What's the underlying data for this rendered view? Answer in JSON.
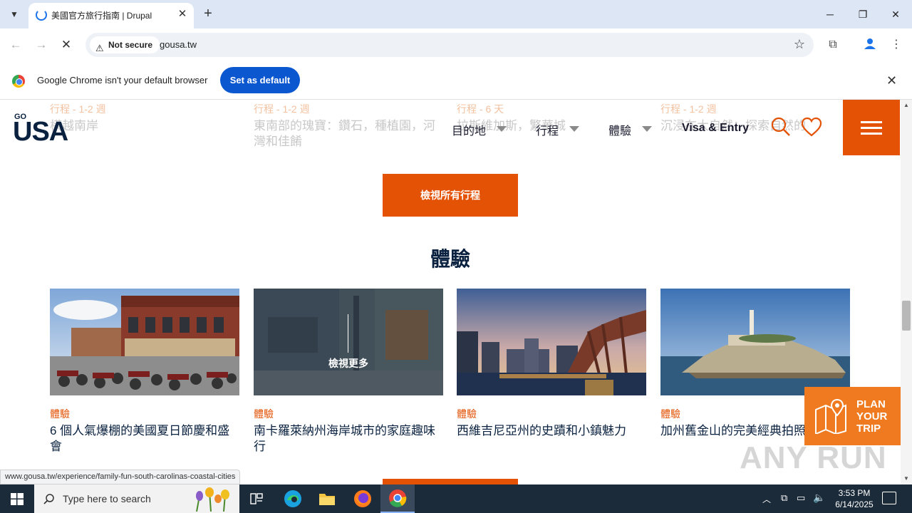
{
  "browser": {
    "tab_title": "美國官方旅行指南 | Drupal",
    "security_label": "Not secure",
    "url": "gousa.tw",
    "infobar_message": "Google Chrome isn't your default browser",
    "set_default_label": "Set as default",
    "status_url": "www.gousa.tw/experience/family-fun-south-carolinas-coastal-cities"
  },
  "faded_trips": [
    {
      "meta": "行程 - 1-2 週",
      "title": "橫越南岸"
    },
    {
      "meta": "行程 - 1-2 週",
      "title": "東南部的瑰寶：鑽石，種植園，河灣和佳餚"
    },
    {
      "meta": "行程 - 6 天",
      "title": "拉斯維加斯，繁華城"
    },
    {
      "meta": "行程 - 1-2 週",
      "title": "沉浸在大自然：探索自然的"
    }
  ],
  "header": {
    "logo_go": "GO",
    "logo_usa": "USA",
    "nav_destinations": "目的地",
    "nav_trips": "行程",
    "nav_experiences": "體驗",
    "nav_visa": "Visa & Entry"
  },
  "main": {
    "view_all_trips": "檢視所有行程",
    "section_title": "體驗",
    "view_more": "檢視更多",
    "cards": [
      {
        "tag": "體驗",
        "title": "6 個人氣爆棚的美國夏日節慶和盛會"
      },
      {
        "tag": "體驗",
        "title": "南卡羅萊納州海岸城市的家庭趣味行"
      },
      {
        "tag": "體驗",
        "title": "西維吉尼亞州的史蹟和小鎮魅力"
      },
      {
        "tag": "體驗",
        "title": "加州舊金山的完美經典拍照"
      }
    ]
  },
  "plan_trip": {
    "line1": "PLAN",
    "line2": "YOUR",
    "line3": "TRIP"
  },
  "watermark": "ANY RUN",
  "taskbar": {
    "search_placeholder": "Type here to search",
    "time": "3:53 PM",
    "date": "6/14/2025"
  },
  "colors": {
    "brand_orange": "#e35205",
    "brand_navy": "#0a2240"
  }
}
